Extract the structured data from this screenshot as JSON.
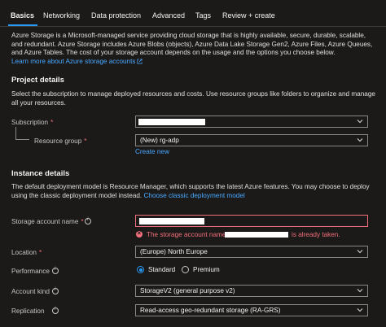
{
  "tabs": [
    {
      "label": "Basics",
      "active": true
    },
    {
      "label": "Networking",
      "active": false
    },
    {
      "label": "Data protection",
      "active": false
    },
    {
      "label": "Advanced",
      "active": false
    },
    {
      "label": "Tags",
      "active": false
    },
    {
      "label": "Review + create",
      "active": false
    }
  ],
  "intro": {
    "text": "Azure Storage is a Microsoft-managed service providing cloud storage that is highly available, secure, durable, scalable, and redundant. Azure Storage includes Azure Blobs (objects), Azure Data Lake Storage Gen2, Azure Files, Azure Queues, and Azure Tables. The cost of your storage account depends on the usage and the options you choose below.",
    "learn_more_link": "Learn more about Azure storage accounts"
  },
  "project_details": {
    "heading": "Project details",
    "description": "Select the subscription to manage deployed resources and costs. Use resource groups like folders to organize and manage all your resources.",
    "subscription_label": "Subscription",
    "resource_group_label": "Resource group",
    "resource_group_value": "(New) rg-adp",
    "create_new_link": "Create new"
  },
  "instance_details": {
    "heading": "Instance details",
    "description": "The default deployment model is Resource Manager, which supports the latest Azure features. You may choose to deploy using the classic deployment model instead.",
    "classic_link": "Choose classic deployment model",
    "storage_account_label": "Storage account name",
    "error_prefix": "The storage account name",
    "error_suffix": "is already taken.",
    "location_label": "Location",
    "location_value": "(Europe) North Europe",
    "performance_label": "Performance",
    "performance_options": [
      "Standard",
      "Premium"
    ],
    "performance_selected": "Standard",
    "account_kind_label": "Account kind",
    "account_kind_value": "StorageV2 (general purpose v2)",
    "replication_label": "Replication",
    "replication_value": "Read-access geo-redundant storage (RA-GRS)"
  },
  "colors": {
    "background": "#1b1a19",
    "accent": "#2899f5",
    "link": "#4aa8ff",
    "error": "#f1707b",
    "required": "#f1707b"
  }
}
